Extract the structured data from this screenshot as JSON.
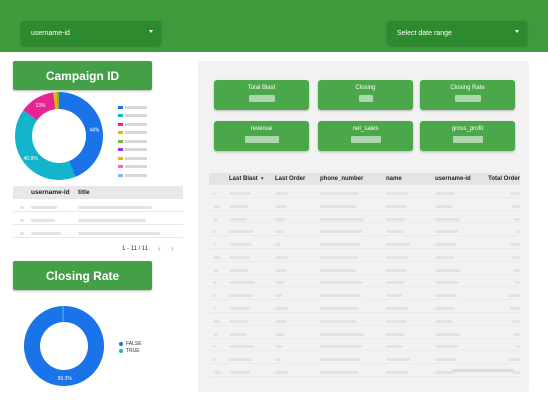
{
  "filters": {
    "username_label": "username-id",
    "date_label": "Select date range"
  },
  "campaign": {
    "title": "Campaign ID",
    "chart_data": {
      "type": "pie",
      "donut": true,
      "slices": [
        {
          "value": 44.0,
          "color": "#1a73e8",
          "label": "44%"
        },
        {
          "value": 40.9,
          "color": "#12b5cb",
          "label": "40.9%"
        },
        {
          "value": 13.0,
          "color": "#e52592",
          "label": "13%"
        },
        {
          "value": 1.2,
          "color": "#f9ab00",
          "label": ""
        },
        {
          "value": 0.9,
          "color": "#7cb342",
          "label": ""
        }
      ],
      "legend_position": "right"
    },
    "legend_colors": [
      "#1a73e8",
      "#12b5cb",
      "#e52592",
      "#f9ab00",
      "#7cb342",
      "#9334e6",
      "#f4b400",
      "#ff63b8",
      "#8ab4f8"
    ],
    "table": {
      "columns": [
        "username-id",
        "title"
      ]
    },
    "pager": "1 - 11 / 11"
  },
  "closing": {
    "title": "Closing Rate",
    "chart_data": {
      "type": "pie",
      "donut": true,
      "slices": [
        {
          "value": 99.3,
          "color": "#1a73e8",
          "label": "99.3%",
          "name": "FALSE"
        },
        {
          "value": 0.7,
          "color": "#12b5cb",
          "label": "",
          "name": "TRUE"
        }
      ],
      "legend_position": "right"
    },
    "legend": [
      "FALSE",
      "TRUE"
    ]
  },
  "kpis": [
    {
      "label": "Total Blast"
    },
    {
      "label": "Closing"
    },
    {
      "label": "Closing Rate"
    },
    {
      "label": "revenue"
    },
    {
      "label": "net_sales"
    },
    {
      "label": "gross_profit"
    }
  ],
  "orders_table": {
    "columns": [
      "",
      "Last Blast",
      "Last Order",
      "phone_number",
      "name",
      "username-id",
      "Total Order"
    ],
    "row_count": 15
  }
}
